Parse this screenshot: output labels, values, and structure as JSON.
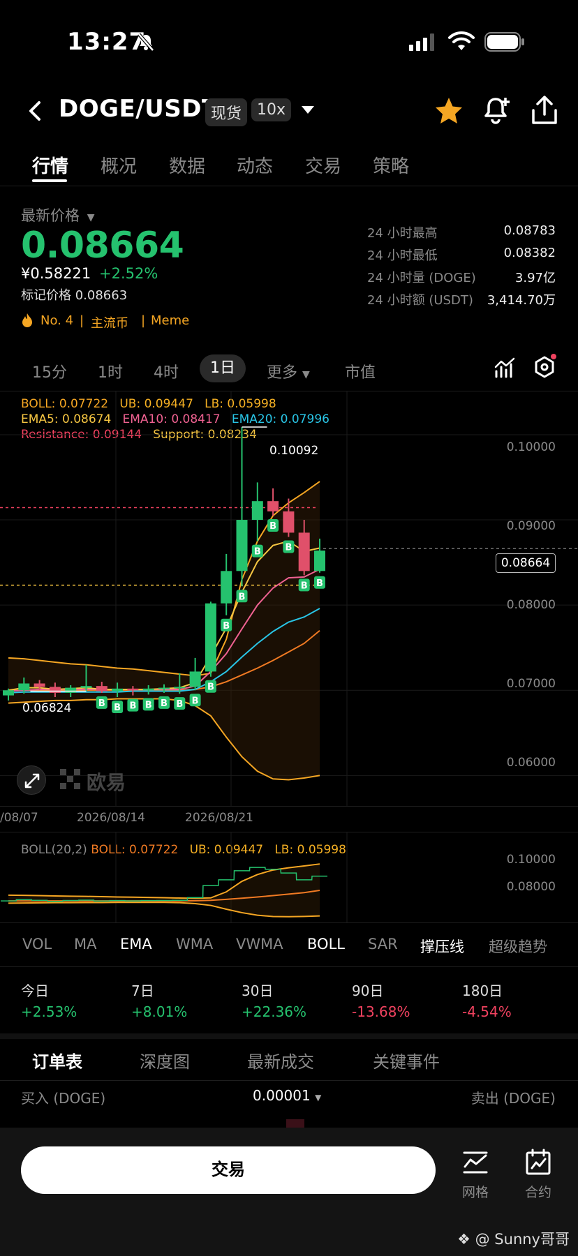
{
  "status_bar": {
    "time": "13:27"
  },
  "header": {
    "title": "DOGE/USDT",
    "spot_tag": "现货",
    "leverage_tag": "10x"
  },
  "tabs": [
    {
      "label": "行情",
      "active": true
    },
    {
      "label": "概况"
    },
    {
      "label": "数据"
    },
    {
      "label": "动态"
    },
    {
      "label": "交易"
    },
    {
      "label": "策略"
    }
  ],
  "price": {
    "label": "最新价格",
    "last": "0.08664",
    "cny": "¥0.58221",
    "change": "+2.52%",
    "mark": "标记价格 0.08663"
  },
  "stats": [
    {
      "label": "24 小时最高",
      "value": "0.08783"
    },
    {
      "label": "24 小时最低",
      "value": "0.08382"
    },
    {
      "label": "24 小时量 (DOGE)",
      "value": "3.97亿"
    },
    {
      "label": "24 小时额 (USDT)",
      "value": "3,414.70万"
    }
  ],
  "meta": {
    "rank": "No. 4",
    "category": "主流币",
    "tag": "Meme",
    "sep": "|"
  },
  "intervals": [
    "15分",
    "1时",
    "4时",
    "1日",
    "更多",
    "市值"
  ],
  "legend": {
    "boll": "BOLL: 0.07722",
    "ub": "UB: 0.09447",
    "lb": "LB: 0.05998",
    "ema5": "EMA5: 0.08674",
    "ema10": "EMA10: 0.08417",
    "ema20": "EMA20: 0.07996",
    "resistance": "Resistance: 0.09144",
    "support": "Support: 0.08234"
  },
  "chart_data": {
    "type": "candlestick",
    "y_ticks": [
      "0.10000",
      "0.09000",
      "0.08000",
      "0.07000",
      "0.06000"
    ],
    "ylim": [
      0.057,
      0.1045
    ],
    "x_ticks": [
      "/08/07",
      "2026/08/14",
      "2026/08/21"
    ],
    "high_label": "0.10092",
    "low_label": "0.06824",
    "current_price": "0.08664",
    "resistance": 0.09144,
    "support": 0.08234,
    "candles": [
      {
        "o": 0.0694,
        "h": 0.0702,
        "l": 0.0688,
        "c": 0.07
      },
      {
        "o": 0.07,
        "h": 0.0715,
        "l": 0.0696,
        "c": 0.0708
      },
      {
        "o": 0.0708,
        "h": 0.0712,
        "l": 0.07,
        "c": 0.0704
      },
      {
        "o": 0.0704,
        "h": 0.0709,
        "l": 0.0692,
        "c": 0.0697
      },
      {
        "o": 0.0697,
        "h": 0.0706,
        "l": 0.0692,
        "c": 0.0703
      },
      {
        "o": 0.0703,
        "h": 0.073,
        "l": 0.0699,
        "c": 0.0705
      },
      {
        "o": 0.0705,
        "h": 0.071,
        "l": 0.0697,
        "c": 0.0699
      },
      {
        "o": 0.0699,
        "h": 0.0709,
        "l": 0.0692,
        "c": 0.0702
      },
      {
        "o": 0.0702,
        "h": 0.0705,
        "l": 0.0694,
        "c": 0.07
      },
      {
        "o": 0.07,
        "h": 0.0706,
        "l": 0.0695,
        "c": 0.0702
      },
      {
        "o": 0.0702,
        "h": 0.0707,
        "l": 0.0697,
        "c": 0.0703
      },
      {
        "o": 0.0703,
        "h": 0.072,
        "l": 0.0696,
        "c": 0.0704
      },
      {
        "o": 0.0704,
        "h": 0.0738,
        "l": 0.07,
        "c": 0.0722
      },
      {
        "o": 0.0722,
        "h": 0.0804,
        "l": 0.0716,
        "c": 0.0802
      },
      {
        "o": 0.0802,
        "h": 0.086,
        "l": 0.0788,
        "c": 0.084
      },
      {
        "o": 0.084,
        "h": 0.1009,
        "l": 0.0822,
        "c": 0.09
      },
      {
        "o": 0.09,
        "h": 0.0944,
        "l": 0.0875,
        "c": 0.0922
      },
      {
        "o": 0.0922,
        "h": 0.0937,
        "l": 0.0905,
        "c": 0.091
      },
      {
        "o": 0.091,
        "h": 0.0925,
        "l": 0.088,
        "c": 0.0885
      },
      {
        "o": 0.0885,
        "h": 0.09,
        "l": 0.0835,
        "c": 0.084
      },
      {
        "o": 0.084,
        "h": 0.0878,
        "l": 0.0838,
        "c": 0.0864
      }
    ],
    "buy_markers_at": [
      6,
      7,
      8,
      9,
      10,
      11,
      12,
      13,
      14,
      15,
      16,
      17,
      18,
      19,
      20
    ],
    "upper_band": [
      0.0738,
      0.0737,
      0.0735,
      0.0733,
      0.0731,
      0.073,
      0.0728,
      0.0726,
      0.0725,
      0.0723,
      0.0721,
      0.0719,
      0.0717,
      0.072,
      0.076,
      0.083,
      0.0875,
      0.0905,
      0.092,
      0.0932,
      0.0945
    ],
    "lower_band": [
      0.0685,
      0.0686,
      0.0687,
      0.0688,
      0.0688,
      0.0689,
      0.0689,
      0.069,
      0.069,
      0.069,
      0.069,
      0.0688,
      0.0682,
      0.067,
      0.0645,
      0.0622,
      0.0605,
      0.0596,
      0.0595,
      0.0597,
      0.06
    ],
    "ema5": [
      0.07,
      0.0703,
      0.0703,
      0.0701,
      0.0702,
      0.0703,
      0.0701,
      0.0701,
      0.0701,
      0.0701,
      0.0702,
      0.0703,
      0.0709,
      0.074,
      0.0773,
      0.0815,
      0.0851,
      0.087,
      0.0875,
      0.0863,
      0.0867
    ],
    "ema10": [
      0.0699,
      0.07,
      0.0701,
      0.0701,
      0.0701,
      0.0701,
      0.0701,
      0.0701,
      0.0701,
      0.0701,
      0.0701,
      0.0701,
      0.0705,
      0.0722,
      0.0743,
      0.0772,
      0.08,
      0.082,
      0.0832,
      0.0833,
      0.0842
    ],
    "ema20": [
      0.0697,
      0.0698,
      0.0698,
      0.0698,
      0.0698,
      0.0698,
      0.0698,
      0.0698,
      0.0699,
      0.0699,
      0.0699,
      0.0699,
      0.0701,
      0.071,
      0.0722,
      0.0739,
      0.0755,
      0.0769,
      0.078,
      0.0786,
      0.0796
    ],
    "mid_band": [
      0.07,
      0.07,
      0.07,
      0.07,
      0.07,
      0.07,
      0.07,
      0.07,
      0.07,
      0.07,
      0.07,
      0.07,
      0.0701,
      0.0704,
      0.071,
      0.0718,
      0.0726,
      0.0735,
      0.0745,
      0.0755,
      0.077
    ]
  },
  "sub_chart": {
    "title": "BOLL(20,2)",
    "boll": "BOLL: 0.07722",
    "ub": "UB: 0.09447",
    "lb": "LB: 0.05998",
    "y_ticks": [
      "0.10000",
      "0.08000"
    ]
  },
  "indicators": [
    "VOL",
    "MA",
    "EMA",
    "WMA",
    "VWMA",
    "BOLL",
    "SAR",
    "撑压线",
    "超级趋势"
  ],
  "performance": [
    {
      "label": "今日",
      "value": "+2.53%",
      "color": "#25c26e"
    },
    {
      "label": "7日",
      "value": "+8.01%",
      "color": "#25c26e"
    },
    {
      "label": "30日",
      "value": "+22.36%",
      "color": "#25c26e"
    },
    {
      "label": "90日",
      "value": "-13.68%",
      "color": "#f0425f"
    },
    {
      "label": "180日",
      "value": "-4.54%",
      "color": "#f0425f"
    }
  ],
  "orderbook_tabs": [
    "订单表",
    "深度图",
    "最新成交",
    "关键事件"
  ],
  "orderbook": {
    "buy_label": "买入 (DOGE)",
    "precision": "0.00001",
    "sell_label": "卖出 (DOGE)"
  },
  "bottom": {
    "trade": "交易",
    "grid": "网格",
    "contract": "合约"
  },
  "brand": "欧易",
  "watermark": "@ Sunny哥哥"
}
